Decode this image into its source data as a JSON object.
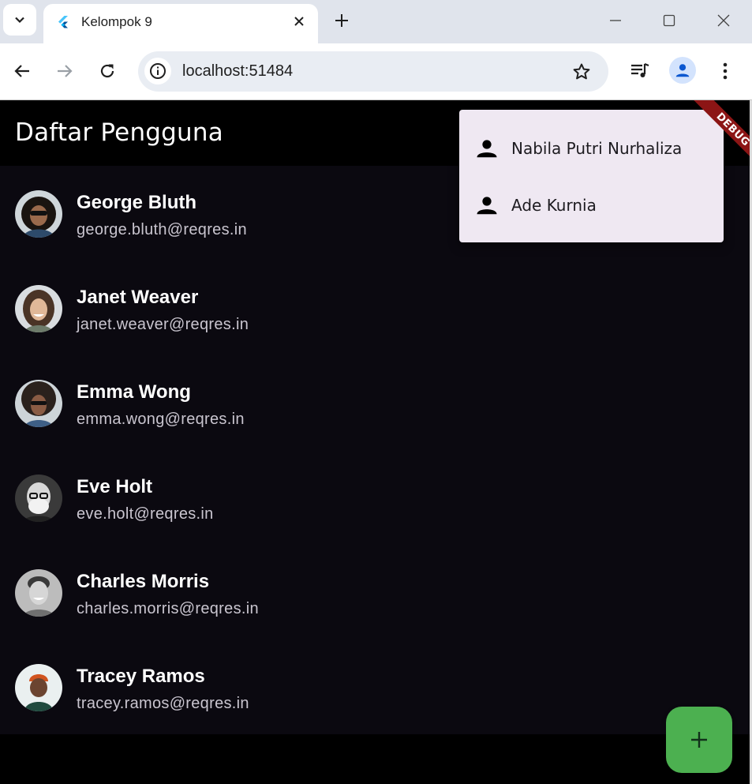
{
  "browser": {
    "tab_title": "Kelompok 9",
    "url": "localhost:51484"
  },
  "app": {
    "title": "Daftar Pengguna",
    "debug_label": "DEBUG",
    "users": [
      {
        "name": "George Bluth",
        "email": "george.bluth@reqres.in"
      },
      {
        "name": "Janet Weaver",
        "email": "janet.weaver@reqres.in"
      },
      {
        "name": "Emma Wong",
        "email": "emma.wong@reqres.in"
      },
      {
        "name": "Eve Holt",
        "email": "eve.holt@reqres.in"
      },
      {
        "name": "Charles Morris",
        "email": "charles.morris@reqres.in"
      },
      {
        "name": "Tracey Ramos",
        "email": "tracey.ramos@reqres.in"
      }
    ],
    "popup_menu": {
      "items": [
        {
          "label": "Nabila Putri Nurhaliza",
          "icon": "person-icon"
        },
        {
          "label": "Ade Kurnia",
          "icon": "person-icon"
        }
      ]
    },
    "fab_icon": "plus-icon"
  },
  "colors": {
    "background": "#0b0910",
    "appbar": "#000000",
    "fab": "#4cb050",
    "menu": "#efe8f2",
    "debug_banner": "#8c1515"
  }
}
